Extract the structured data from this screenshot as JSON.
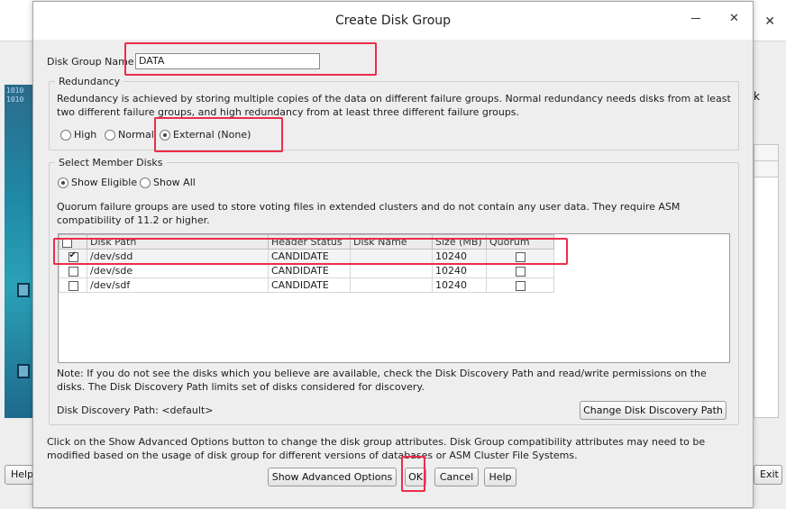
{
  "background_window": {
    "partial_label": "k",
    "side_text": "1010\n1010",
    "help_button": "Help",
    "exit_button": "Exit"
  },
  "dialog": {
    "title": "Create Disk Group",
    "disk_group_name_label": "Disk Group Name",
    "disk_group_name_value": "DATA",
    "redundancy": {
      "legend": "Redundancy",
      "description": "Redundancy is achieved by storing multiple copies of the data on different failure groups. Normal redundancy needs disks from at least two different failure groups, and high redundancy from at least three different failure groups.",
      "options": [
        {
          "label": "High",
          "selected": false
        },
        {
          "label": "Normal",
          "selected": false
        },
        {
          "label": "External (None)",
          "selected": true
        }
      ]
    },
    "member_disks": {
      "legend": "Select Member Disks",
      "filter_options": [
        {
          "label": "Show Eligible",
          "selected": true
        },
        {
          "label": "Show All",
          "selected": false
        }
      ],
      "quorum_note": "Quorum failure groups are used to store voting files in extended clusters and do not contain any user data. They require ASM compatibility of 11.2 or higher.",
      "columns": [
        "Disk Path",
        "Header Status",
        "Disk Name",
        "Size (MB)",
        "Quorum"
      ],
      "rows": [
        {
          "selected": true,
          "path": "/dev/sdd",
          "status": "CANDIDATE",
          "name": "",
          "size": "10240",
          "quorum": false
        },
        {
          "selected": false,
          "path": "/dev/sde",
          "status": "CANDIDATE",
          "name": "",
          "size": "10240",
          "quorum": false
        },
        {
          "selected": false,
          "path": "/dev/sdf",
          "status": "CANDIDATE",
          "name": "",
          "size": "10240",
          "quorum": false
        }
      ],
      "discovery_note": "Note: If you do not see the disks which you believe are available, check the Disk Discovery Path and read/write permissions on the disks. The Disk Discovery Path limits set of disks considered for discovery.",
      "discovery_path_label": "Disk Discovery Path: <default>",
      "change_path_button": "Change Disk Discovery Path"
    },
    "advanced_note": "Click on the Show Advanced Options button to change the disk group attributes. Disk Group compatibility attributes may need to be modified based on the usage of disk group for different versions of databases or ASM Cluster File Systems.",
    "buttons": {
      "advanced": "Show Advanced Options",
      "ok": "OK",
      "cancel": "Cancel",
      "help": "Help"
    }
  },
  "colors": {
    "highlight": "#ee2c4a",
    "dialog_bg": "#eeeeee"
  }
}
